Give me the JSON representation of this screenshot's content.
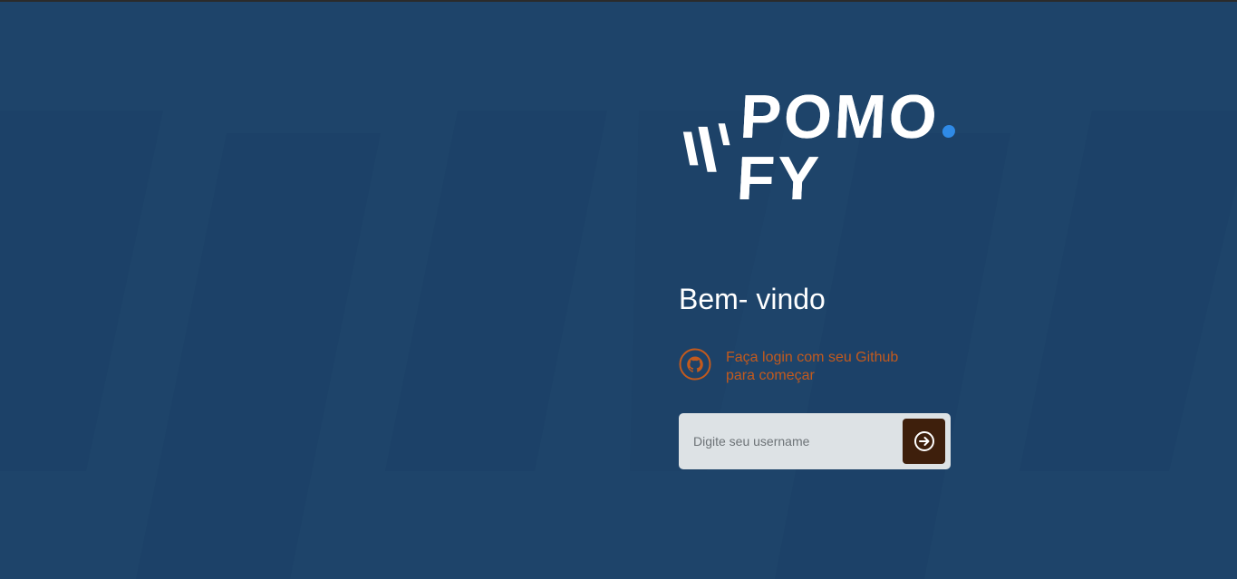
{
  "app": {
    "logo_text": "POMO",
    "logo_suffix": "FY"
  },
  "main": {
    "welcome_title": "Bem- vindo",
    "github_line1": "Faça login com seu Github",
    "github_line2": "para começar",
    "github_icon": "github-icon"
  },
  "login": {
    "username_placeholder": "Digite seu username",
    "username_value": "",
    "submit_icon": "arrow-right-circle-icon"
  },
  "colors": {
    "background": "#1e446a",
    "accent_orange": "#c35a1d",
    "logo_dot": "#2f8ae6",
    "button_bg": "#3e1f0c",
    "input_bg": "#dde2e5"
  }
}
